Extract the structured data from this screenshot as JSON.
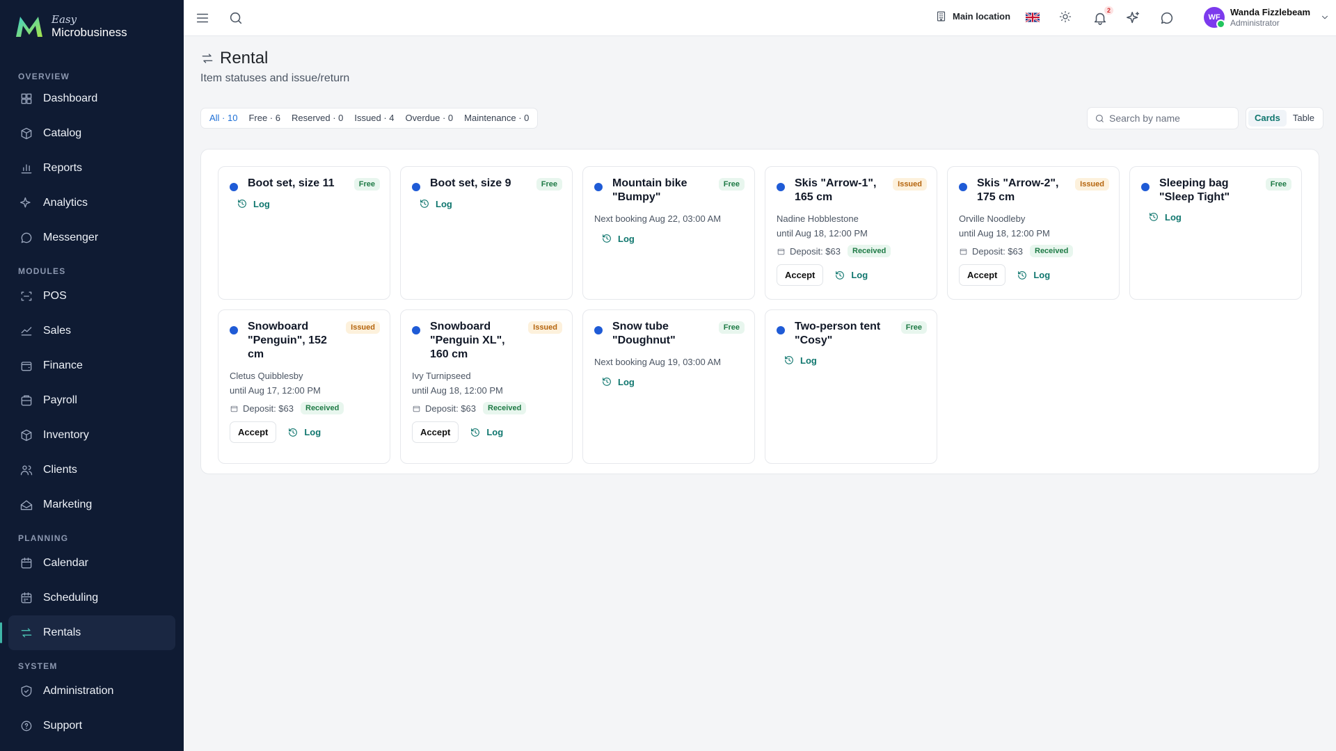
{
  "brand": {
    "easy": "Easy",
    "name": "Microbusiness"
  },
  "sidebar": {
    "sections": [
      {
        "title": "OVERVIEW",
        "items": [
          {
            "label": "Dashboard",
            "icon": "dashboard-icon"
          },
          {
            "label": "Catalog",
            "icon": "catalog-icon"
          },
          {
            "label": "Reports",
            "icon": "reports-icon"
          },
          {
            "label": "Analytics",
            "icon": "analytics-icon"
          },
          {
            "label": "Messenger",
            "icon": "messenger-icon"
          }
        ]
      },
      {
        "title": "MODULES",
        "items": [
          {
            "label": "POS",
            "icon": "pos-icon"
          },
          {
            "label": "Sales",
            "icon": "sales-icon"
          },
          {
            "label": "Finance",
            "icon": "finance-icon"
          },
          {
            "label": "Payroll",
            "icon": "payroll-icon"
          },
          {
            "label": "Inventory",
            "icon": "inventory-icon"
          },
          {
            "label": "Clients",
            "icon": "clients-icon"
          },
          {
            "label": "Marketing",
            "icon": "marketing-icon"
          }
        ]
      },
      {
        "title": "PLANNING",
        "items": [
          {
            "label": "Calendar",
            "icon": "calendar-icon"
          },
          {
            "label": "Scheduling",
            "icon": "scheduling-icon"
          },
          {
            "label": "Rentals",
            "icon": "rentals-icon",
            "active": true
          }
        ]
      },
      {
        "title": "SYSTEM",
        "items": [
          {
            "label": "Administration",
            "icon": "administration-icon"
          },
          {
            "label": "Support",
            "icon": "support-icon"
          }
        ]
      }
    ]
  },
  "topbar": {
    "location": "Main location",
    "notifications_count": "2",
    "user": {
      "initials": "WF",
      "name": "Wanda Fizzlebeam",
      "role": "Administrator"
    }
  },
  "page": {
    "title": "Rental",
    "subtitle": "Item statuses and issue/return"
  },
  "filters": [
    {
      "label": "All · 10",
      "active": true
    },
    {
      "label": "Free · 6"
    },
    {
      "label": "Reserved · 0"
    },
    {
      "label": "Issued · 4"
    },
    {
      "label": "Overdue · 0"
    },
    {
      "label": "Maintenance · 0"
    }
  ],
  "search": {
    "placeholder": "Search by name"
  },
  "view_toggle": {
    "cards": "Cards",
    "table": "Table",
    "active": "Cards"
  },
  "labels": {
    "log": "Log",
    "accept": "Accept",
    "received": "Received"
  },
  "colors": {
    "sidebar_bg": "#0f1b33",
    "accent": "#0f766e",
    "dot": "#1f5bd6",
    "free": "#1e7a45",
    "issued": "#b5650e"
  },
  "items": [
    {
      "title": "Boot set, size 11",
      "status": "Free"
    },
    {
      "title": "Boot set, size 9",
      "status": "Free"
    },
    {
      "title": "Mountain bike \"Bumpy\"",
      "status": "Free",
      "booking": "Next booking Aug 22, 03:00 AM"
    },
    {
      "title": "Skis \"Arrow-1\", 165 cm",
      "status": "Issued",
      "client": "Nadine Hobblestone",
      "until": "until Aug 18, 12:00 PM",
      "deposit": "Deposit: $63"
    },
    {
      "title": "Skis \"Arrow-2\", 175 cm",
      "status": "Issued",
      "client": "Orville Noodleby",
      "until": "until Aug 18, 12:00 PM",
      "deposit": "Deposit: $63"
    },
    {
      "title": "Sleeping bag \"Sleep Tight\"",
      "status": "Free"
    },
    {
      "title": "Snowboard \"Penguin\", 152 cm",
      "status": "Issued",
      "client": "Cletus Quibblesby",
      "until": "until Aug 17, 12:00 PM",
      "deposit": "Deposit: $63"
    },
    {
      "title": "Snowboard \"Penguin XL\", 160 cm",
      "status": "Issued",
      "client": "Ivy Turnipseed",
      "until": "until Aug 18, 12:00 PM",
      "deposit": "Deposit: $63"
    },
    {
      "title": "Snow tube \"Doughnut\"",
      "status": "Free",
      "booking": "Next booking Aug 19, 03:00 AM"
    },
    {
      "title": "Two-person tent \"Cosy\"",
      "status": "Free"
    }
  ]
}
